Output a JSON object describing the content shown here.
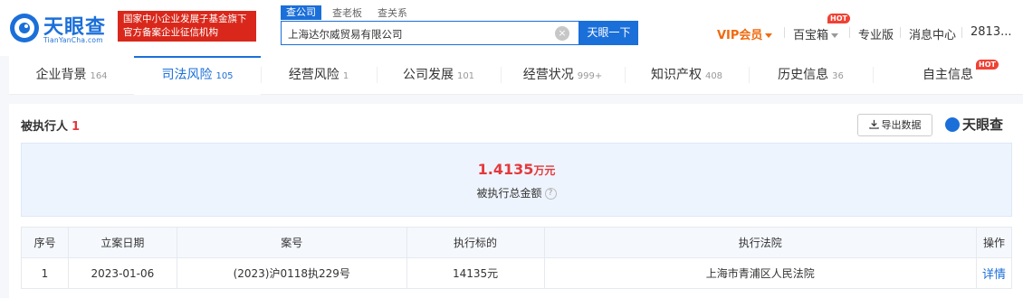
{
  "brand": {
    "name": "天眼查",
    "sub": "TianYanCha.com",
    "promo_line1": "国家中小企业发展子基金旗下",
    "promo_line2": "官方备案企业征信机构"
  },
  "search": {
    "tabs": [
      "查公司",
      "查老板",
      "查关系"
    ],
    "value": "上海达尔威贸易有限公司",
    "clear": "×",
    "button": "天眼一下"
  },
  "nav": {
    "vip": "VIP会员",
    "treasure": "百宝箱",
    "hot": "HOT",
    "pro": "专业版",
    "messages": "消息中心",
    "user": "2813..."
  },
  "tabs": [
    {
      "label": "企业背景",
      "count": "164"
    },
    {
      "label": "司法风险",
      "count": "105"
    },
    {
      "label": "经营风险",
      "count": "1"
    },
    {
      "label": "公司发展",
      "count": "101"
    },
    {
      "label": "经营状况",
      "count": "999+"
    },
    {
      "label": "知识产权",
      "count": "408"
    },
    {
      "label": "历史信息",
      "count": "36"
    },
    {
      "label": "自主信息",
      "count": ""
    }
  ],
  "section": {
    "title": "被执行人",
    "count": "1",
    "export": "导出数据",
    "brand": "天眼查"
  },
  "summary": {
    "amount": "1.4135",
    "unit": "万元",
    "label": "被执行总金额",
    "help": "?"
  },
  "table": {
    "headers": [
      "序号",
      "立案日期",
      "案号",
      "执行标的",
      "执行法院",
      "操作"
    ],
    "rows": [
      [
        "1",
        "2023-01-06",
        "(2023)沪0118执229号",
        "14135元",
        "上海市青浦区人民法院",
        "详情"
      ]
    ]
  },
  "colors": {
    "primary": "#1b6fd9",
    "accent_red": "#e4393c",
    "vip_orange": "#f06a0e"
  }
}
